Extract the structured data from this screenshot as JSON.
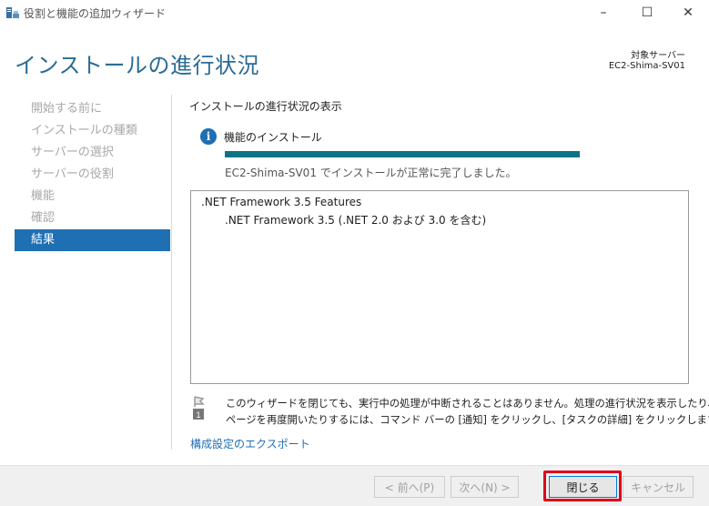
{
  "window": {
    "title": "役割と機能の追加ウィザード",
    "controls": {
      "minimize": "–",
      "maximize": "☐",
      "close": "✕"
    }
  },
  "header": {
    "page_title": "インストールの進行状況",
    "target_label": "対象サーバー",
    "target_server": "EC2-Shima-SV01"
  },
  "sidebar": {
    "items": [
      {
        "label": "開始する前に",
        "active": false
      },
      {
        "label": "インストールの種類",
        "active": false
      },
      {
        "label": "サーバーの選択",
        "active": false
      },
      {
        "label": "サーバーの役割",
        "active": false
      },
      {
        "label": "機能",
        "active": false
      },
      {
        "label": "確認",
        "active": false
      },
      {
        "label": "結果",
        "active": true
      }
    ]
  },
  "main": {
    "section_label": "インストールの進行状況の表示",
    "install_title": "機能のインストール",
    "progress": 1.0,
    "status": "EC2-Shima-SV01 でインストールが正常に完了しました。",
    "results": [
      ".NET Framework 3.5 Features",
      ".NET Framework 3.5 (.NET 2.0 および 3.0 を含む)"
    ],
    "note": {
      "badge": "1",
      "line1": "このウィザードを閉じても、実行中の処理が中断されることはありません。処理の進行状況を表示したり、この",
      "line2": "ページを再度開いたりするには、コマンド バーの [通知] をクリックし、[タスクの詳細] をクリックします。"
    },
    "export_link": "構成設定のエクスポート"
  },
  "footer": {
    "prev": "< 前へ(P)",
    "next": "次へ(N) >",
    "close": "閉じる",
    "cancel": "キャンセル"
  },
  "colors": {
    "accent": "#1f6fb3",
    "progress": "#0e7484",
    "highlight": "#e0001b"
  }
}
